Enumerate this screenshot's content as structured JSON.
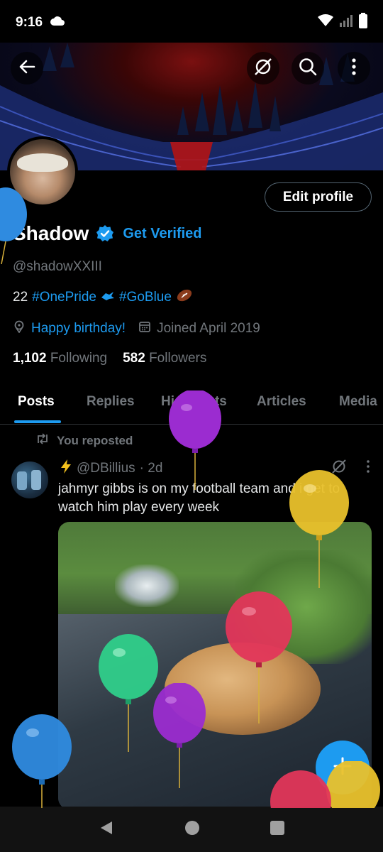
{
  "status_bar": {
    "time": "9:16"
  },
  "profile": {
    "display_name": "Shadow",
    "get_verified_label": "Get Verified",
    "handle": "@shadowXXIII",
    "bio_prefix": "22",
    "bio_tag_1": "#OnePride",
    "bio_tag_2": "#GoBlue",
    "birthday_text": "Happy birthday!",
    "joined_text": "Joined April 2019",
    "following_count": "1,102",
    "following_label": "Following",
    "followers_count": "582",
    "followers_label": "Followers",
    "edit_profile_label": "Edit profile"
  },
  "tabs": [
    {
      "label": "Posts"
    },
    {
      "label": "Replies"
    },
    {
      "label": "Highlights"
    },
    {
      "label": "Articles"
    },
    {
      "label": "Media"
    }
  ],
  "post": {
    "repost_label": "You reposted",
    "author_handle": "@DBillius",
    "time_ago": "· 2d",
    "text": "jahmyr gibbs is on my football team and i get to watch him play every week"
  },
  "colors": {
    "accent": "#1d9bf0",
    "background": "#000000",
    "muted_text": "#71767b"
  },
  "icons": {
    "back": "arrow-left-icon",
    "grok": "grok-icon",
    "search": "search-icon",
    "more": "more-vertical-icon",
    "compose": "plus-icon"
  }
}
